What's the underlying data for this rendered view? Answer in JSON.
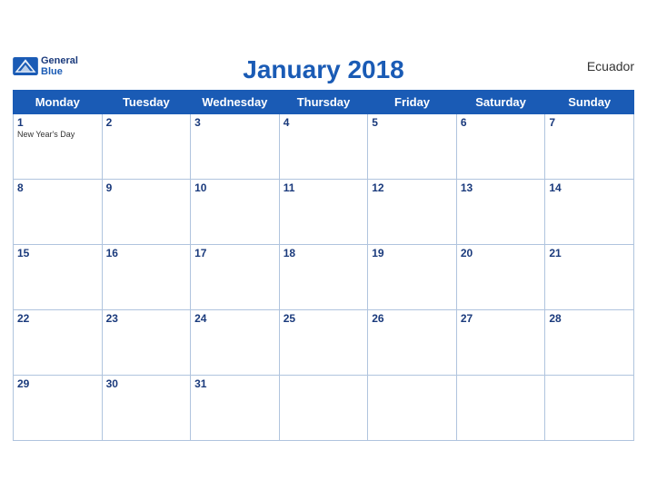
{
  "header": {
    "month_year": "January 2018",
    "country": "Ecuador",
    "logo_line1": "General",
    "logo_line2": "Blue"
  },
  "days_of_week": [
    "Monday",
    "Tuesday",
    "Wednesday",
    "Thursday",
    "Friday",
    "Saturday",
    "Sunday"
  ],
  "weeks": [
    [
      {
        "day": "1",
        "holiday": "New Year's Day"
      },
      {
        "day": "2",
        "holiday": ""
      },
      {
        "day": "3",
        "holiday": ""
      },
      {
        "day": "4",
        "holiday": ""
      },
      {
        "day": "5",
        "holiday": ""
      },
      {
        "day": "6",
        "holiday": ""
      },
      {
        "day": "7",
        "holiday": ""
      }
    ],
    [
      {
        "day": "8",
        "holiday": ""
      },
      {
        "day": "9",
        "holiday": ""
      },
      {
        "day": "10",
        "holiday": ""
      },
      {
        "day": "11",
        "holiday": ""
      },
      {
        "day": "12",
        "holiday": ""
      },
      {
        "day": "13",
        "holiday": ""
      },
      {
        "day": "14",
        "holiday": ""
      }
    ],
    [
      {
        "day": "15",
        "holiday": ""
      },
      {
        "day": "16",
        "holiday": ""
      },
      {
        "day": "17",
        "holiday": ""
      },
      {
        "day": "18",
        "holiday": ""
      },
      {
        "day": "19",
        "holiday": ""
      },
      {
        "day": "20",
        "holiday": ""
      },
      {
        "day": "21",
        "holiday": ""
      }
    ],
    [
      {
        "day": "22",
        "holiday": ""
      },
      {
        "day": "23",
        "holiday": ""
      },
      {
        "day": "24",
        "holiday": ""
      },
      {
        "day": "25",
        "holiday": ""
      },
      {
        "day": "26",
        "holiday": ""
      },
      {
        "day": "27",
        "holiday": ""
      },
      {
        "day": "28",
        "holiday": ""
      }
    ],
    [
      {
        "day": "29",
        "holiday": ""
      },
      {
        "day": "30",
        "holiday": ""
      },
      {
        "day": "31",
        "holiday": ""
      },
      {
        "day": "",
        "holiday": ""
      },
      {
        "day": "",
        "holiday": ""
      },
      {
        "day": "",
        "holiday": ""
      },
      {
        "day": "",
        "holiday": ""
      }
    ]
  ]
}
